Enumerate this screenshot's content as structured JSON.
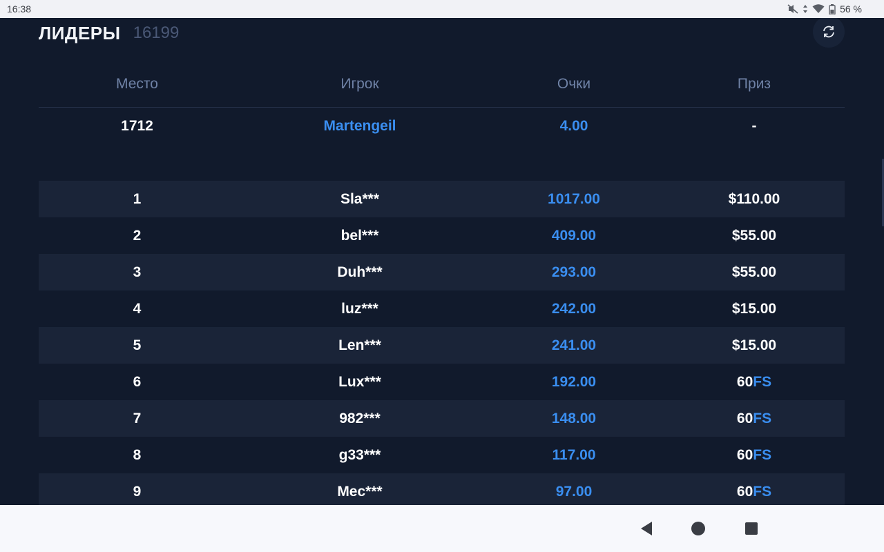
{
  "status_bar": {
    "time": "16:38",
    "battery": "56 %"
  },
  "header": {
    "title": "ЛИДЕРЫ",
    "count": "16199"
  },
  "table": {
    "columns": [
      "Место",
      "Игрок",
      "Очки",
      "Приз"
    ],
    "my_row": {
      "place": "1712",
      "player": "Martengeil",
      "points": "4.00",
      "prize": "-"
    },
    "rows": [
      {
        "place": "1",
        "player": "Sla***",
        "points": "1017.00",
        "prize": "$110.00",
        "prize_suffix": ""
      },
      {
        "place": "2",
        "player": "bel***",
        "points": "409.00",
        "prize": "$55.00",
        "prize_suffix": ""
      },
      {
        "place": "3",
        "player": "Duh***",
        "points": "293.00",
        "prize": "$55.00",
        "prize_suffix": ""
      },
      {
        "place": "4",
        "player": "luz***",
        "points": "242.00",
        "prize": "$15.00",
        "prize_suffix": ""
      },
      {
        "place": "5",
        "player": "Len***",
        "points": "241.00",
        "prize": "$15.00",
        "prize_suffix": ""
      },
      {
        "place": "6",
        "player": "Lux***",
        "points": "192.00",
        "prize": "60",
        "prize_suffix": "FS"
      },
      {
        "place": "7",
        "player": "982***",
        "points": "148.00",
        "prize": "60",
        "prize_suffix": "FS"
      },
      {
        "place": "8",
        "player": "g33***",
        "points": "117.00",
        "prize": "60",
        "prize_suffix": "FS"
      },
      {
        "place": "9",
        "player": "Mec***",
        "points": "97.00",
        "prize": "60",
        "prize_suffix": "FS"
      }
    ]
  },
  "icons": {
    "refresh": "refresh-icon",
    "back": "back-icon",
    "home": "home-icon",
    "recents": "recents-icon"
  },
  "colors": {
    "background": "#111a2c",
    "row_alt": "#1a2438",
    "accent_blue": "#3a8ef0",
    "header_muted": "#6f82a6"
  }
}
